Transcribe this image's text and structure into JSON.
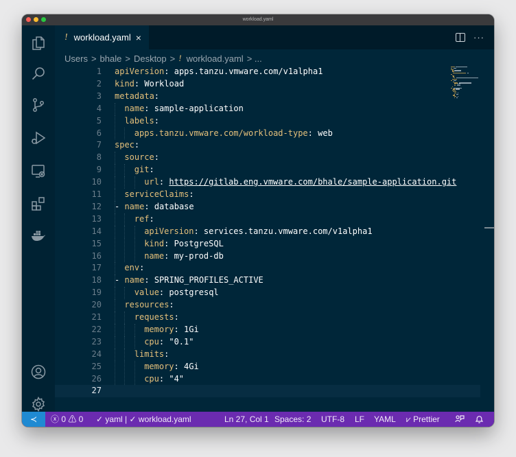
{
  "window": {
    "title": "workload.yaml"
  },
  "activity_bar": {
    "items": [
      {
        "name": "explorer-icon"
      },
      {
        "name": "search-icon"
      },
      {
        "name": "source-control-icon"
      },
      {
        "name": "run-debug-icon"
      },
      {
        "name": "remote-explorer-icon"
      },
      {
        "name": "extensions-icon"
      },
      {
        "name": "docker-icon"
      }
    ],
    "bottom": [
      {
        "name": "account-icon"
      },
      {
        "name": "settings-gear-icon"
      }
    ]
  },
  "tab": {
    "icon_glyph": "!",
    "label": "workload.yaml",
    "close_glyph": "×"
  },
  "tab_actions": {
    "more_glyph": "···"
  },
  "breadcrumb": {
    "items": [
      "Users",
      "bhale",
      "Desktop"
    ],
    "separator": ">",
    "file_glyph": "!",
    "file": "workload.yaml",
    "trailing": "> ..."
  },
  "editor": {
    "current_line": 27,
    "lines": [
      {
        "n": "1",
        "indent": 0,
        "key": "apiVersion",
        "value": "apps.tanzu.vmware.com/v1alpha1"
      },
      {
        "n": "2",
        "indent": 0,
        "key": "kind",
        "value": "Workload"
      },
      {
        "n": "3",
        "indent": 0,
        "key": "metadata",
        "value": ""
      },
      {
        "n": "4",
        "indent": 1,
        "key": "name",
        "value": "sample-application"
      },
      {
        "n": "5",
        "indent": 1,
        "key": "labels",
        "value": ""
      },
      {
        "n": "6",
        "indent": 2,
        "key": "apps.tanzu.vmware.com/workload-type",
        "value": "web"
      },
      {
        "n": "7",
        "indent": 0,
        "key": "spec",
        "value": ""
      },
      {
        "n": "8",
        "indent": 1,
        "key": "source",
        "value": ""
      },
      {
        "n": "9",
        "indent": 2,
        "key": "git",
        "value": ""
      },
      {
        "n": "10",
        "indent": 3,
        "key": "url",
        "value": "https://gitlab.eng.vmware.com/bhale/sample-application.git",
        "link": true
      },
      {
        "n": "11",
        "indent": 1,
        "key": "serviceClaims",
        "value": ""
      },
      {
        "n": "12",
        "indent": 1,
        "dash": true,
        "key": "name",
        "value": "database"
      },
      {
        "n": "13",
        "indent": 2,
        "key": "ref",
        "value": ""
      },
      {
        "n": "14",
        "indent": 3,
        "key": "apiVersion",
        "value": "services.tanzu.vmware.com/v1alpha1"
      },
      {
        "n": "15",
        "indent": 3,
        "key": "kind",
        "value": "PostgreSQL"
      },
      {
        "n": "16",
        "indent": 3,
        "key": "name",
        "value": "my-prod-db"
      },
      {
        "n": "17",
        "indent": 1,
        "key": "env",
        "value": ""
      },
      {
        "n": "18",
        "indent": 1,
        "dash": true,
        "key": "name",
        "value": "SPRING_PROFILES_ACTIVE"
      },
      {
        "n": "19",
        "indent": 2,
        "key": "value",
        "value": "postgresql"
      },
      {
        "n": "20",
        "indent": 1,
        "key": "resources",
        "value": ""
      },
      {
        "n": "21",
        "indent": 2,
        "key": "requests",
        "value": ""
      },
      {
        "n": "22",
        "indent": 3,
        "key": "memory",
        "value": "1Gi"
      },
      {
        "n": "23",
        "indent": 3,
        "key": "cpu",
        "value": "\"0.1\""
      },
      {
        "n": "24",
        "indent": 2,
        "key": "limits",
        "value": ""
      },
      {
        "n": "25",
        "indent": 3,
        "key": "memory",
        "value": "4Gi"
      },
      {
        "n": "26",
        "indent": 3,
        "key": "cpu",
        "value": "\"4\""
      },
      {
        "n": "27",
        "indent": 0,
        "key": "",
        "value": ""
      }
    ]
  },
  "status_bar": {
    "remote_glyph": "≺",
    "problems": "ⓧ 0 ⚠ 0",
    "schema": "✓ yaml | ✓ workload.yaml",
    "position": "Ln 27, Col 1",
    "spaces": "Spaces: 2",
    "encoding": "UTF-8",
    "eol": "LF",
    "language": "YAML",
    "formatter": "⩗ Prettier",
    "feedback_icon": "feedback-icon",
    "bell_icon": "bell-icon"
  },
  "colors": {
    "editor_bg": "#002639",
    "key": "#e5c07b",
    "status_bar": "#6b2bb0",
    "remote": "#1f8ad2"
  }
}
